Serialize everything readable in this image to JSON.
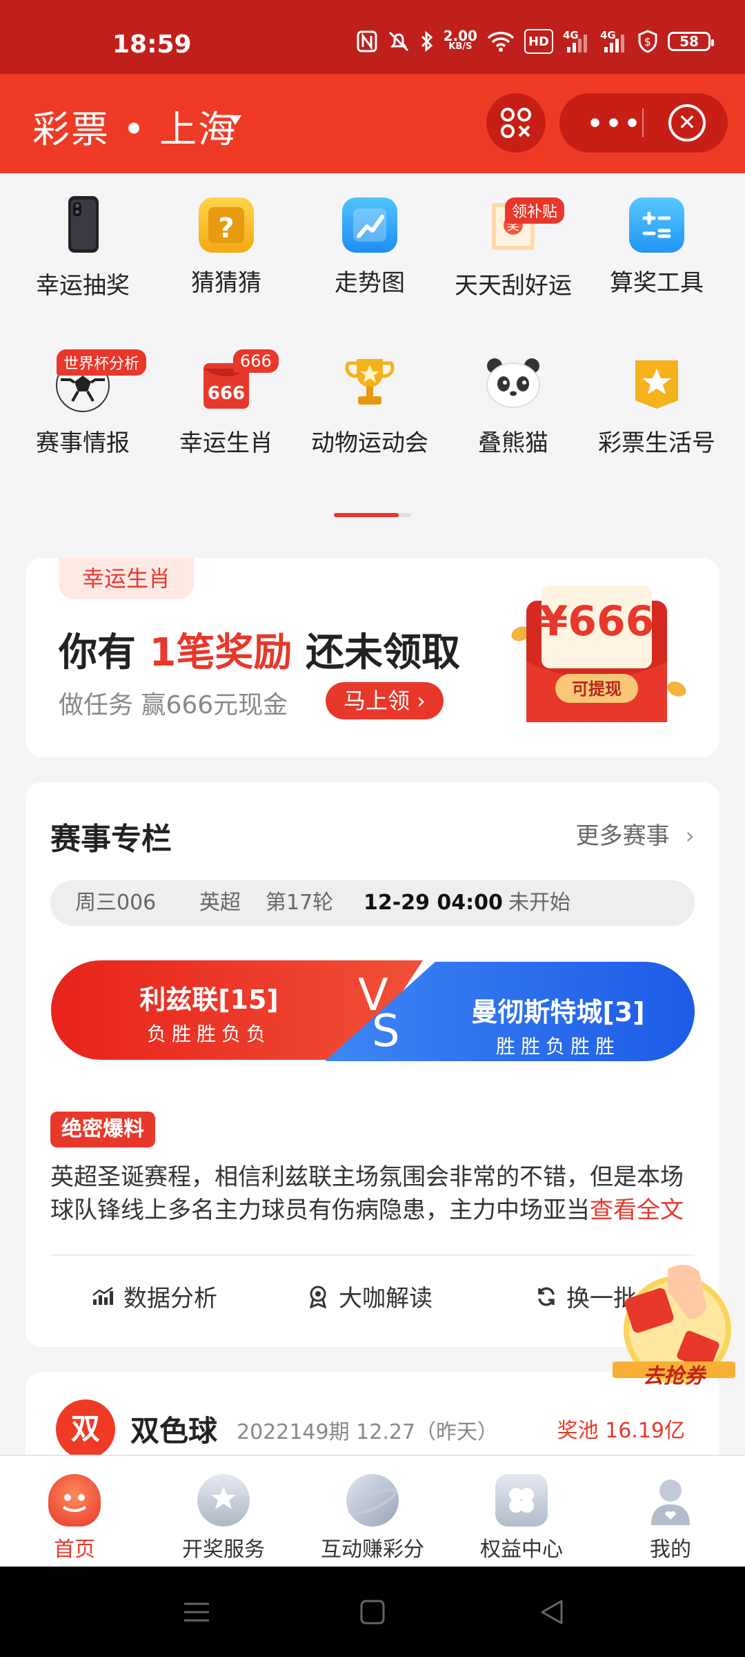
{
  "status_bar": {
    "time": "18:59",
    "net_speed_value": "2.00",
    "net_speed_unit": "KB/S",
    "hd_label": "HD",
    "sig1_label": "4G",
    "sig2_label": "4G",
    "battery": "58"
  },
  "header": {
    "title": "彩票 • 上海"
  },
  "grid": {
    "items": [
      {
        "label": "幸运抽奖",
        "icon": "phone-prize-icon"
      },
      {
        "label": "猜猜猜",
        "icon": "question-box-icon"
      },
      {
        "label": "走势图",
        "icon": "trend-chart-icon"
      },
      {
        "label": "天天刮好运",
        "icon": "scratch-ticket-icon",
        "tag": "领补贴"
      },
      {
        "label": "算奖工具",
        "icon": "calculator-icon"
      },
      {
        "label": "赛事情报",
        "icon": "soccer-ball-icon",
        "tag": "世界杯分析"
      },
      {
        "label": "幸运生肖",
        "icon": "red-envelope-666-icon",
        "tag": "666",
        "icon_text": "666"
      },
      {
        "label": "动物运动会",
        "icon": "trophy-icon"
      },
      {
        "label": "叠熊猫",
        "icon": "panda-icon"
      },
      {
        "label": "彩票生活号",
        "icon": "star-badge-icon"
      }
    ]
  },
  "reward": {
    "tag": "幸运生肖",
    "title_pre": "你有 ",
    "title_highlight": "1笔奖励",
    "title_post": " 还未领取",
    "subtitle": "做任务 赢666元现金",
    "button": "马上领",
    "envelope_amount": "¥666",
    "envelope_button": "可提现"
  },
  "match": {
    "title": "赛事专栏",
    "more": "更多赛事",
    "info": {
      "code": "周三006",
      "league": "英超",
      "round": "第17轮",
      "time": "12-29 04:00",
      "status": "未开始"
    },
    "home": {
      "name": "利兹联[15]",
      "record": "负胜胜负负"
    },
    "away": {
      "name": "曼彻斯特城[3]",
      "record": "胜胜负胜胜"
    },
    "vs_v": "V",
    "vs_s": "S",
    "secret_tag": "绝密爆料",
    "secret_text": "英超圣诞赛程，相信利兹联主场氛围会非常的不错，但是本场球队锋线上多名主力球员有伤病隐患，主力中场亚当",
    "read_more": "查看全文",
    "actions": {
      "data": "数据分析",
      "expert": "大咖解读",
      "refresh": "换一批"
    }
  },
  "lottery": {
    "icon_text": "双",
    "name": "双色球",
    "issue": "2022149期  12.27（昨天）",
    "pool": "奖池 16.19亿"
  },
  "coupon": {
    "label": "去抢券"
  },
  "tabbar": {
    "tabs": [
      {
        "label": "首页",
        "active": true
      },
      {
        "label": "开奖服务"
      },
      {
        "label": "互动赚彩分"
      },
      {
        "label": "权益中心"
      },
      {
        "label": "我的"
      }
    ]
  },
  "colors": {
    "brand_red": "#e8382b",
    "header_red": "#ef3b26",
    "status_red": "#c0201c",
    "away_blue": "#2f6df0"
  }
}
